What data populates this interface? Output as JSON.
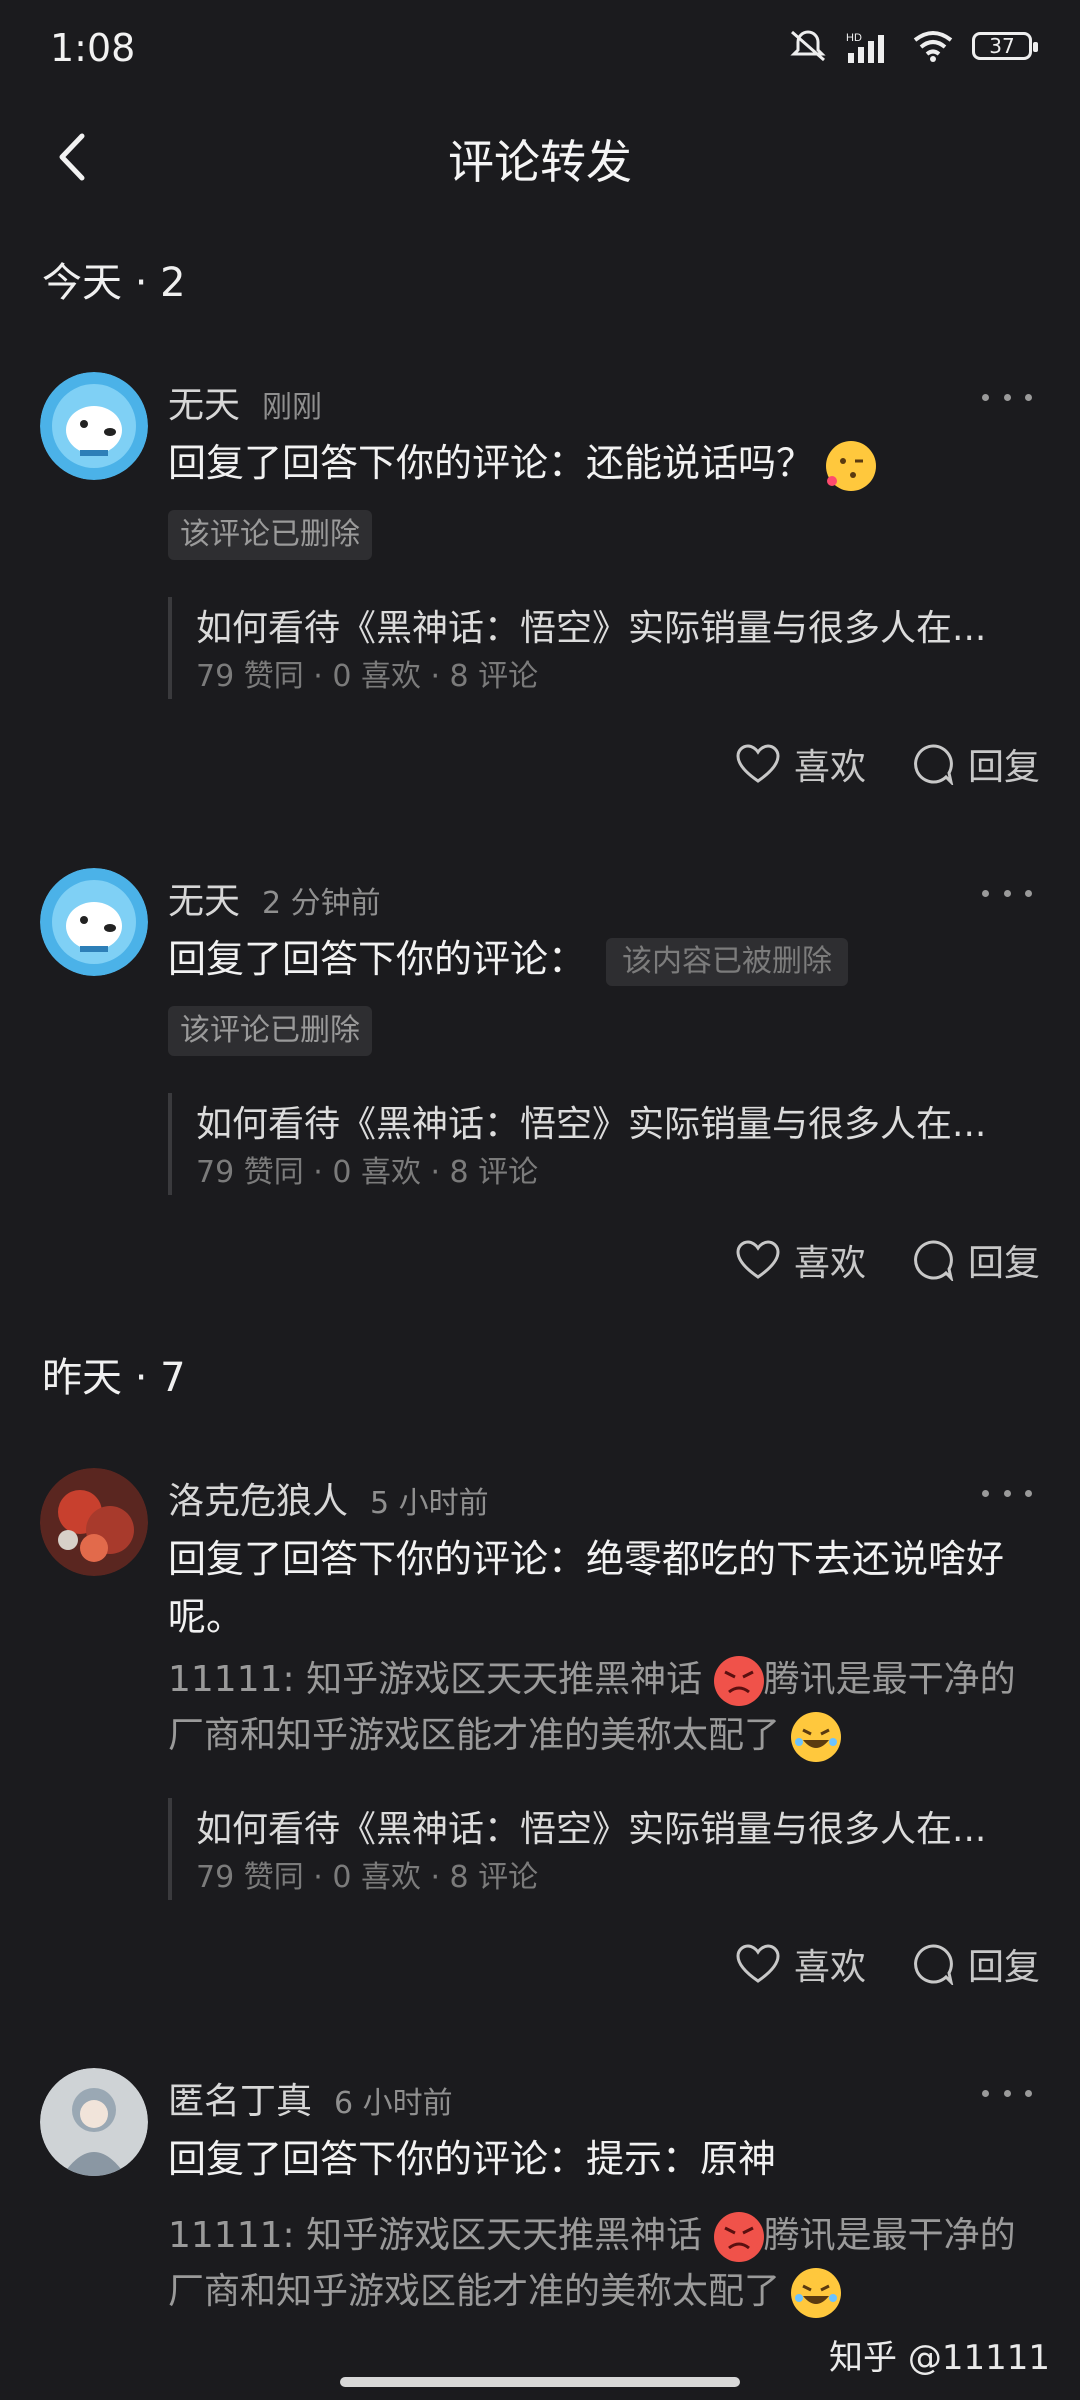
{
  "status_bar": {
    "time": "1:08",
    "network": "HD",
    "battery": "37"
  },
  "nav": {
    "title": "评论转发"
  },
  "sections": [
    {
      "header": "今天 · 2"
    },
    {
      "header": "昨天 · 7"
    }
  ],
  "items": [
    {
      "username": "无天",
      "time": "刚刚",
      "reply": "回复了回答下你的评论：还能说话吗？",
      "reply_emoji": "winking-kiss-emoji",
      "deleted_tag": "该评论已删除",
      "quote_title": "如何看待《黑神话：悟空》实际销量与很多人在...",
      "quote_stats": "79 赞同 · 0 喜欢 · 8 评论",
      "like_label": "喜欢",
      "reply_label": "回复"
    },
    {
      "username": "无天",
      "time": "2 分钟前",
      "reply": "回复了回答下你的评论：",
      "inline_deleted": "该内容已被删除",
      "deleted_tag": "该评论已删除",
      "quote_title": "如何看待《黑神话：悟空》实际销量与很多人在...",
      "quote_stats": "79 赞同 · 0 喜欢 · 8 评论",
      "like_label": "喜欢",
      "reply_label": "回复"
    },
    {
      "username": "洛克危狼人",
      "time": "5 小时前",
      "reply": "回复了回答下你的评论：绝零都吃的下去还说啥好呢。",
      "quoted_comment_a": "11111: 知乎游戏区天天推黑神话",
      "quoted_comment_b": "腾讯是最干净的厂商和知乎游戏区能才准的美称太配了",
      "quote_title": "如何看待《黑神话：悟空》实际销量与很多人在...",
      "quote_stats": "79 赞同 · 0 喜欢 · 8 评论",
      "like_label": "喜欢",
      "reply_label": "回复"
    },
    {
      "username": "匿名丁真",
      "time": "6 小时前",
      "reply": "回复了回答下你的评论：提示：原神",
      "quoted_comment_a": "11111: 知乎游戏区天天推黑神话",
      "quoted_comment_b": "腾讯是最干净的厂商和知乎游戏区能才准的美称太配了"
    }
  ],
  "watermark": "知乎 @11111",
  "colors": {
    "background": "#1b1b1e",
    "text": "#f2f2f2",
    "muted": "#8f8f8f"
  }
}
